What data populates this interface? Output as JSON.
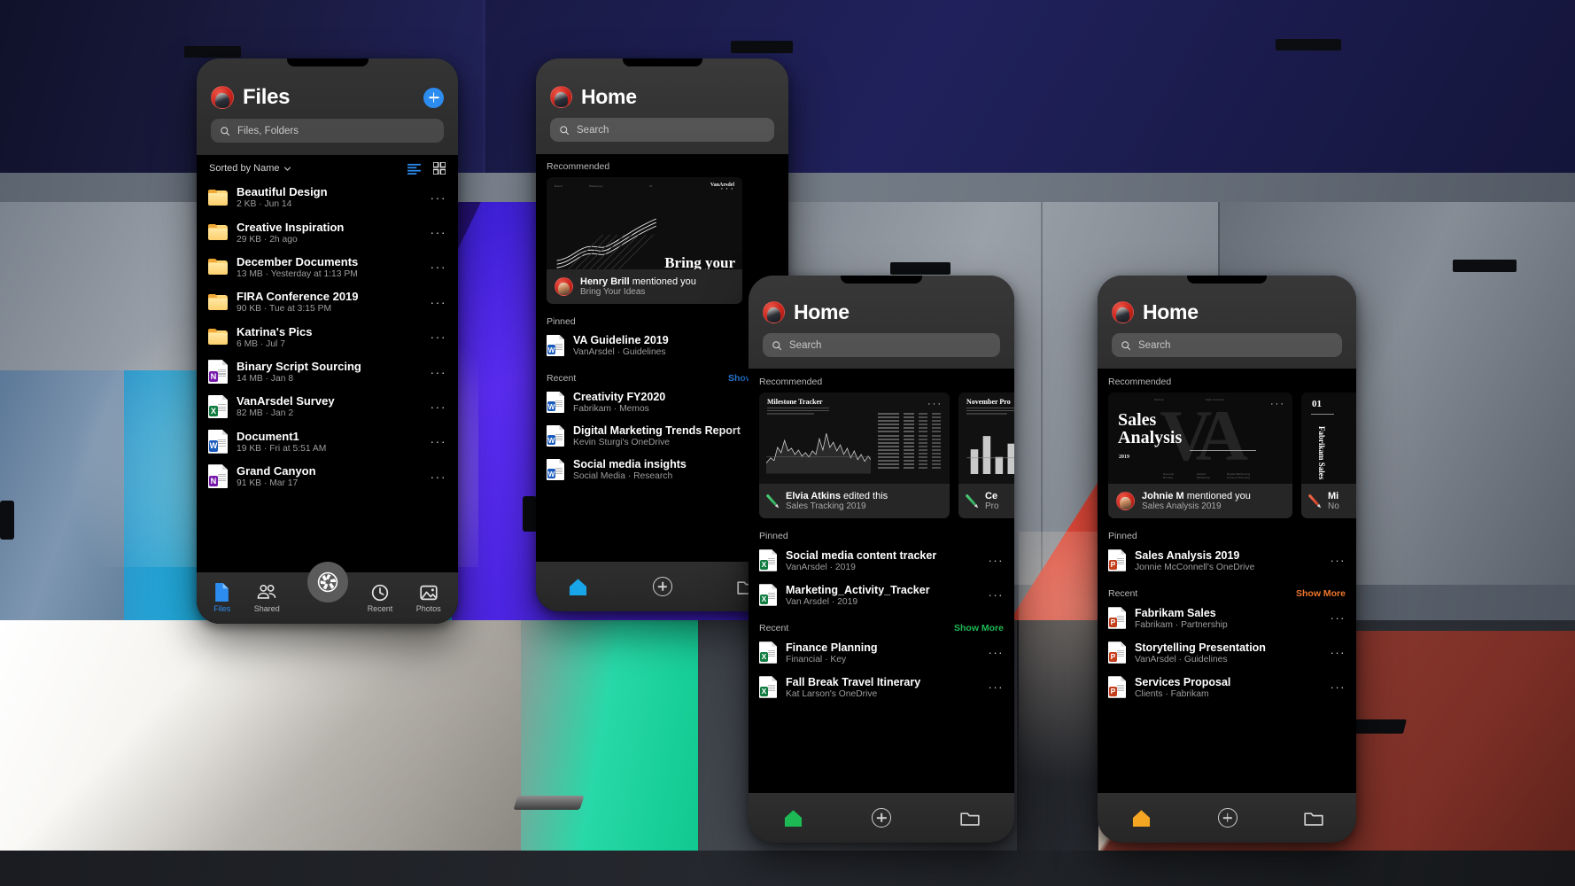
{
  "scene": {
    "description": "Four Microsoft Office mobile app screens floating over a colorful studio backdrop"
  },
  "phone1": {
    "header": {
      "title": "Files",
      "avatar": "user-avatar",
      "add_button": "plus-icon"
    },
    "search": {
      "placeholder": "Files, Folders",
      "icon": "search-icon"
    },
    "toolbar": {
      "sort_label": "Sorted by Name",
      "sort_chevron": "chevron-down-icon",
      "list_view_icon": "list-view-icon",
      "grid_view_icon": "grid-view-icon"
    },
    "items": [
      {
        "name": "Beautiful Design",
        "meta": "2 KB · Jun 14",
        "icon": "folder"
      },
      {
        "name": "Creative Inspiration",
        "meta": "29 KB · 2h ago",
        "icon": "folder"
      },
      {
        "name": "December Documents",
        "meta": "13 MB · Yesterday at 1:13 PM",
        "icon": "folder"
      },
      {
        "name": "FIRA Conference 2019",
        "meta": "90 KB · Tue at 3:15 PM",
        "icon": "folder"
      },
      {
        "name": "Katrina's Pics",
        "meta": "6 MB · Jul 7",
        "icon": "folder"
      },
      {
        "name": "Binary Script Sourcing",
        "meta": "14 MB · Jan 8",
        "icon": "onenote",
        "badge": "N",
        "color": "#7719aa"
      },
      {
        "name": "VanArsdel Survey",
        "meta": "82 MB · Jan 2",
        "icon": "excel",
        "badge": "X",
        "color": "#107c41"
      },
      {
        "name": "Document1",
        "meta": "19 KB · Fri at 5:51 AM",
        "icon": "word",
        "badge": "W",
        "color": "#185abd"
      },
      {
        "name": "Grand Canyon",
        "meta": "91 KB · Mar 17",
        "icon": "onenote",
        "badge": "N",
        "color": "#7719aa"
      }
    ],
    "row_menu": "···",
    "tabs": [
      {
        "label": "Files",
        "icon": "file-icon",
        "active": true
      },
      {
        "label": "Shared",
        "icon": "people-icon",
        "active": false
      },
      {
        "label": "Recent",
        "icon": "clock-icon",
        "active": false
      },
      {
        "label": "Photos",
        "icon": "photo-icon",
        "active": false
      }
    ],
    "scan_button": "camera-scan-icon",
    "accent": "#2d8cf0"
  },
  "phone2": {
    "header": {
      "title": "Home",
      "avatar": "user-avatar"
    },
    "search": {
      "placeholder": "Search",
      "icon": "search-icon"
    },
    "sections": {
      "recommended": "Recommended",
      "pinned": "Pinned",
      "recent": "Recent",
      "show_more": "Show More"
    },
    "recommended": [
      {
        "slide_title": "Bring your",
        "brand": "VanArsdel",
        "label_left": "Brand",
        "label_mid": "Marketing",
        "label_num": "01",
        "actor": "Henry Brill",
        "action": "mentioned you",
        "file": "Bring Your Ideas",
        "badge": "avatar"
      }
    ],
    "pinned": [
      {
        "name": "VA Guideline 2019",
        "meta": "VanArsdel · Guidelines",
        "badge": "W",
        "color": "#185abd"
      }
    ],
    "recent": [
      {
        "name": "Creativity FY2020",
        "meta": "Fabrikam · Memos",
        "badge": "W",
        "color": "#185abd"
      },
      {
        "name": "Digital Marketing Trends Report",
        "meta": "Kevin Sturgi's OneDrive",
        "badge": "W",
        "color": "#185abd"
      },
      {
        "name": "Social media insights",
        "meta": "Social Media · Research",
        "badge": "W",
        "color": "#185abd"
      }
    ],
    "tabs": [
      {
        "icon": "home-icon",
        "active": true
      },
      {
        "icon": "plus-icon",
        "active": false
      },
      {
        "icon": "folder-icon",
        "active": false
      }
    ],
    "accent": "#2b88f0"
  },
  "phone3": {
    "header": {
      "title": "Home",
      "avatar": "user-avatar"
    },
    "search": {
      "placeholder": "Search",
      "icon": "search-icon"
    },
    "sections": {
      "recommended": "Recommended",
      "pinned": "Pinned",
      "recent": "Recent",
      "show_more": "Show More"
    },
    "recommended": [
      {
        "slide_title": "Milestone Tracker",
        "actor": "Elvia Atkins",
        "action": "edited this",
        "file": "Sales Tracking 2019",
        "badge": "pencil"
      },
      {
        "slide_title": "November Pro",
        "actor": "Ce",
        "action": "",
        "file": "Pro",
        "badge": "pencil"
      }
    ],
    "pinned": [
      {
        "name": "Social media content tracker",
        "meta": "VanArsdel · 2019",
        "badge": "X",
        "color": "#107c41"
      },
      {
        "name": "Marketing_Activity_Tracker",
        "meta": "Van Arsdel · 2019",
        "badge": "X",
        "color": "#107c41"
      }
    ],
    "recent": [
      {
        "name": "Finance Planning",
        "meta": "Financial · Key",
        "badge": "X",
        "color": "#107c41"
      },
      {
        "name": "Fall Break Travel Itinerary",
        "meta": "Kat Larson's OneDrive",
        "badge": "X",
        "color": "#107c41"
      }
    ],
    "row_menu": "···",
    "tabs": [
      {
        "icon": "home-icon",
        "active": true
      },
      {
        "icon": "plus-icon",
        "active": false
      },
      {
        "icon": "folder-icon",
        "active": false
      }
    ],
    "accent": "#1db954"
  },
  "phone4": {
    "header": {
      "title": "Home",
      "avatar": "user-avatar"
    },
    "search": {
      "placeholder": "Search",
      "icon": "search-icon"
    },
    "sections": {
      "recommended": "Recommended",
      "pinned": "Pinned",
      "recent": "Recent",
      "show_more": "Show More"
    },
    "recommended": [
      {
        "slide_title_l1": "Sales",
        "slide_title_l2": "Analysis",
        "slide_year": "2019",
        "slide_watermark": "VA",
        "actor": "Johnie M",
        "action": "mentioned you",
        "file": "Sales Analysis 2019",
        "badge": "avatar"
      },
      {
        "slide_num": "01",
        "slide_vertical": "Fabrikam Sales",
        "actor": "Mi",
        "action": "",
        "file": "No",
        "badge": "pencil"
      }
    ],
    "pinned": [
      {
        "name": "Sales Analysis 2019",
        "meta": "Jonnie McConnell's OneDrive",
        "badge": "P",
        "color": "#c43e1c"
      }
    ],
    "recent": [
      {
        "name": "Fabrikam Sales",
        "meta": "Fabrikam · Partnership",
        "badge": "P",
        "color": "#c43e1c"
      },
      {
        "name": "Storytelling Presentation",
        "meta": "VanArsdel · Guidelines",
        "badge": "P",
        "color": "#c43e1c"
      },
      {
        "name": "Services Proposal",
        "meta": "Clients · Fabrikam",
        "badge": "P",
        "color": "#c43e1c"
      }
    ],
    "row_menu": "···",
    "tabs": [
      {
        "icon": "home-icon",
        "active": true
      },
      {
        "icon": "plus-icon",
        "active": false
      },
      {
        "icon": "folder-icon",
        "active": false
      }
    ],
    "accent": "#f09030"
  }
}
